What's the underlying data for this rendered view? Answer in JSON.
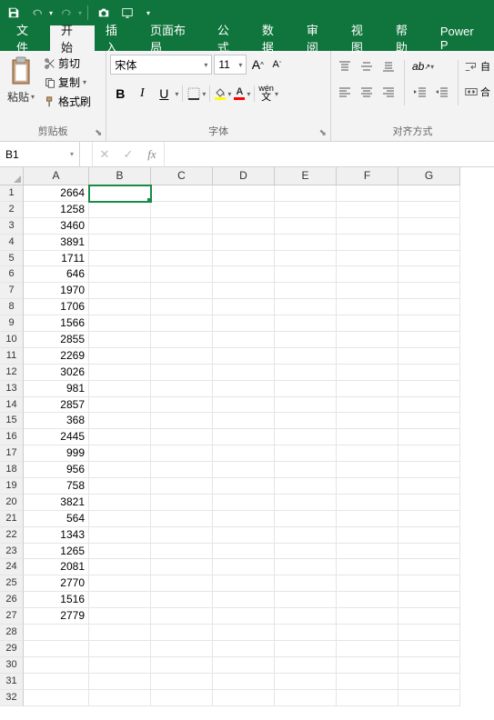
{
  "titlebar": {
    "icons": [
      "save",
      "undo",
      "redo",
      "camera",
      "touch"
    ]
  },
  "ribbon": {
    "tabs": [
      "文件",
      "开始",
      "插入",
      "页面布局",
      "公式",
      "数据",
      "审阅",
      "视图",
      "帮助",
      "Power P"
    ],
    "active_tab_index": 1,
    "clipboard": {
      "paste_label": "粘贴",
      "cut_label": "剪切",
      "copy_label": "复制",
      "format_painter_label": "格式刷",
      "group_label": "剪贴板"
    },
    "font": {
      "name": "宋体",
      "size": "11",
      "inc_label": "A",
      "dec_label": "A",
      "bold": "B",
      "italic": "I",
      "underline": "U",
      "wen": "wén",
      "group_label": "字体"
    },
    "align": {
      "group_label": "对齐方式"
    }
  },
  "formula_bar": {
    "name_box": "B1",
    "cancel": "✕",
    "enter": "✓",
    "fx": "fx",
    "formula": ""
  },
  "grid": {
    "columns": [
      "A",
      "B",
      "C",
      "D",
      "E",
      "F",
      "G"
    ],
    "selected_cell": "B1",
    "row_count": 32,
    "data_A": [
      "2664",
      "1258",
      "3460",
      "3891",
      "1711",
      "646",
      "1970",
      "1706",
      "1566",
      "2855",
      "2269",
      "3026",
      "981",
      "2857",
      "368",
      "2445",
      "999",
      "956",
      "758",
      "3821",
      "564",
      "1343",
      "1265",
      "2081",
      "2770",
      "1516",
      "2779",
      "",
      "",
      "",
      "",
      ""
    ]
  }
}
